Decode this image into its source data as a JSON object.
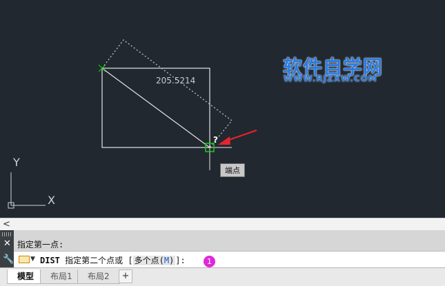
{
  "canvas": {
    "dimension_text": "205.5214",
    "tooltip_text": "端点",
    "cursor_question": "?",
    "ucs_y_label": "Y",
    "ucs_x_label": "X"
  },
  "watermark": {
    "title": "软件自学网",
    "url": "WWW.RJZXW.COM"
  },
  "scrollbar": {
    "arrow": "<"
  },
  "command": {
    "history_line": "指定第一点:",
    "prompt_command": "DIST",
    "prompt_text": " 指定第二个点或 [",
    "option_text": "多个点(",
    "option_key": "M",
    "option_close": ")",
    "prompt_end": "]:",
    "badge": "1"
  },
  "tabs": {
    "items": [
      "模型",
      "布局1",
      "布局2"
    ],
    "add": "+"
  },
  "colors": {
    "canvas_bg": "#212830",
    "snap_marker": "#17c617",
    "arrow": "#e8232d",
    "watermark": "#2a7be0",
    "badge": "#e028d8"
  }
}
